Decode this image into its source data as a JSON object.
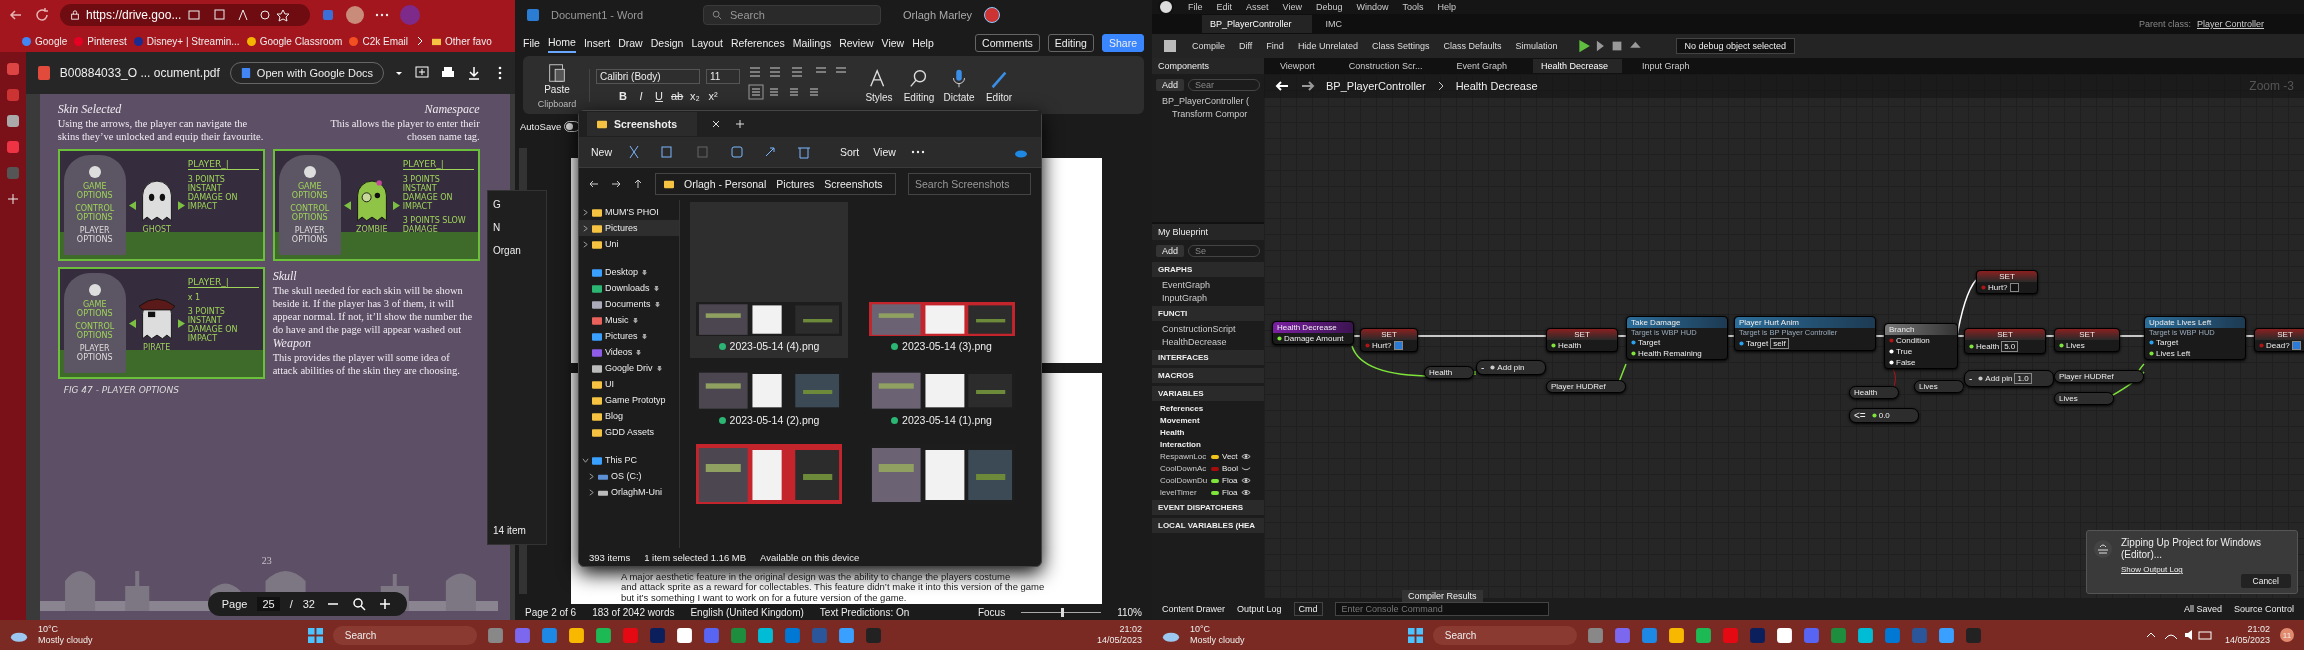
{
  "browser": {
    "url": "https://drive.goo...",
    "bookmarks": [
      {
        "label": "Google",
        "color": "#4285f4"
      },
      {
        "label": "Pinterest",
        "color": "#e60023"
      },
      {
        "label": "Disney+ | Streamin...",
        "color": "#1a2c8f"
      },
      {
        "label": "Google Classroom",
        "color": "#f4b400"
      },
      {
        "label": "C2k Email",
        "color": "#f25022"
      }
    ],
    "other_bookmarks": "Other favo"
  },
  "pdf_viewer": {
    "file_name": "B00884033_O ... ocument.pdf",
    "open_with_button": "Open with Google Docs",
    "page_label": "Page",
    "page": "25",
    "page_separator": "/",
    "page_total": "32"
  },
  "document_page": {
    "skin_selected": {
      "heading": "Skin Selected",
      "lines": [
        "Using the arrows, the player can navigate the",
        "skins they’ve unlocked and equip their favourite."
      ]
    },
    "namespace": {
      "heading": "Namespace",
      "lines": [
        "This allows the player to enter their",
        "chosen name tag."
      ]
    },
    "skull": {
      "heading": "Skull",
      "lines": [
        "The skull needed for each skin will be shown",
        "beside it. If the player has 3 of them, it will",
        "appear normal. If not, it’ll show the number the",
        "do have and the page will appear washed out"
      ]
    },
    "weapon": {
      "heading": "Weapon",
      "lines": [
        "This provides the player will some idea of",
        "attack abilities of the skin they are choosing."
      ]
    },
    "cards": [
      {
        "kind": "ghost",
        "menu": [
          "GAME OPTIONS",
          "CONTROL OPTIONS",
          "PLAYER OPTIONS"
        ],
        "name_tag": "PLAYER_|",
        "skin_name": "GHOST",
        "abilities": [
          "3 POINTS INSTANT DAMAGE ON IMPACT"
        ]
      },
      {
        "kind": "zombie",
        "menu": [
          "GAME OPTIONS",
          "CONTROL OPTIONS",
          "PLAYER OPTIONS"
        ],
        "name_tag": "PLAYER_|",
        "skin_name": "ZOMBIE",
        "abilities": [
          "3 POINTS INSTANT DAMAGE ON IMPACT",
          "3 POINTS SLOW DAMAGE"
        ]
      },
      {
        "kind": "pirate",
        "menu": [
          "GAME OPTIONS",
          "CONTROL OPTIONS",
          "PLAYER OPTIONS"
        ],
        "name_tag": "PLAYER_|",
        "skin_name": "PIRATE",
        "skull_count": "x 1",
        "abilities": [
          "3 POINTS INSTANT DAMAGE ON IMPACT"
        ]
      }
    ],
    "caption": "FIG 47 - PLAYER OPTIONS",
    "page_number": "23"
  },
  "word": {
    "title": "Document1 - Word",
    "search": "Search",
    "user": "Orlagh Marley",
    "tabs": [
      {
        "label": "File",
        "selected": false
      },
      {
        "label": "Home",
        "selected": true
      },
      {
        "label": "Insert",
        "selected": false
      },
      {
        "label": "Draw",
        "selected": false
      },
      {
        "label": "Design",
        "selected": false
      },
      {
        "label": "Layout",
        "selected": false
      },
      {
        "label": "References",
        "selected": false
      },
      {
        "label": "Mailings",
        "selected": false
      },
      {
        "label": "Review",
        "selected": false
      },
      {
        "label": "View",
        "selected": false
      },
      {
        "label": "Help",
        "selected": false
      }
    ],
    "comments_button": "Comments",
    "editing_button": "Editing",
    "share_button": "Share",
    "paste": "Paste",
    "clipboard_group": "Clipboard",
    "font": "Calibri (Body)",
    "font_size": "11",
    "format_buttons": [
      "B",
      "I",
      "U",
      "ab",
      "x₂",
      "x²"
    ],
    "big_buttons": [
      {
        "label": "Styles",
        "kind": "styles"
      },
      {
        "label": "Editing",
        "kind": "editing"
      },
      {
        "label": "Dictate",
        "kind": "dictate"
      },
      {
        "label": "Editor",
        "kind": "editor"
      }
    ],
    "autosave": {
      "label": "AutoSave",
      "on": false
    },
    "body_lines": [
      "A major aesthetic feature in the original design was the ability to change the players costume",
      "and attack sprite as a reward for collectables. This feature didn’t make it into this version of the game",
      "but it’s something I want to work on for a future version of the game."
    ],
    "status": {
      "page": "Page 2 of 6",
      "words": "183 of 2042 words",
      "language": "English (United Kingdom)",
      "predictions": "Text Predictions: On",
      "focus": "Focus",
      "zoom": "110%",
      "zoom_level": {
        "level": 0.5
      }
    }
  },
  "explorer_behind": {
    "tab": "G",
    "new": "N",
    "organise": "Organ",
    "items": "14 item"
  },
  "explorer": {
    "tab": "Screenshots",
    "new": "New",
    "sort": "Sort",
    "view": "View",
    "path": [
      "Orlagh - Personal",
      "Pictures",
      "Screenshots"
    ],
    "search_placeholder": "Search Screenshots",
    "nav_groups": [
      [
        {
          "label": "MUM'S PHOI",
          "kind": "folder",
          "expanded": false,
          "selected": false
        },
        {
          "label": "Pictures",
          "kind": "folder",
          "expanded": false,
          "selected": true
        },
        {
          "label": "Uni",
          "kind": "folder",
          "expanded": false,
          "selected": false
        }
      ],
      [
        {
          "label": "Desktop",
          "kind": "desktop",
          "pinned": true,
          "selected": false
        },
        {
          "label": "Downloads",
          "kind": "downloads",
          "pinned": true,
          "selected": false
        },
        {
          "label": "Documents",
          "kind": "documents",
          "pinned": true,
          "selected": false
        },
        {
          "label": "Music",
          "kind": "music",
          "pinned": true,
          "selected": false
        },
        {
          "label": "Pictures",
          "kind": "pictures",
          "pinned": true,
          "selected": false
        },
        {
          "label": "Videos",
          "kind": "videos",
          "pinned": true,
          "selected": false
        },
        {
          "label": "Google Driv",
          "kind": "drive",
          "pinned": true,
          "selected": false
        },
        {
          "label": "UI",
          "kind": "cloud-folder",
          "selected": false
        },
        {
          "label": "Game Prototyp",
          "kind": "cloud-folder",
          "selected": false
        },
        {
          "label": "Blog",
          "kind": "cloud-folder",
          "selected": false
        },
        {
          "label": "GDD Assets",
          "kind": "cloud-folder",
          "selected": false
        }
      ],
      [
        {
          "label": "This PC",
          "kind": "pc",
          "expanded": true,
          "selected": false,
          "children": [
            {
              "label": "OS (C:)",
              "kind": "disk",
              "expanded": false,
              "selected": false
            },
            {
              "label": "OrlaghM-Uni",
              "kind": "drive",
              "expanded": false,
              "selected": false
            }
          ]
        }
      ]
    ],
    "files": [
      {
        "name": "2023-05-14 (4).png",
        "selected": true
      },
      {
        "name": "2023-05-14 (3).png",
        "selected": false
      },
      {
        "name": "2023-05-14 (2).png",
        "selected": false
      },
      {
        "name": "2023-05-14 (1).png",
        "selected": false
      },
      {
        "selected": false
      },
      {
        "selected": false
      }
    ],
    "status": [
      "393 items",
      "1 item selected  1.16 MB",
      "Available on this device"
    ]
  },
  "taskbar_left": {
    "temperature": "10°C",
    "weather": "Mostly cloudy",
    "search": "Search",
    "time": "21:02",
    "date": "14/05/2023"
  },
  "unreal": {
    "menu": [
      "File",
      "Edit",
      "Asset",
      "View",
      "Debug",
      "Window",
      "Tools",
      "Help"
    ],
    "tabs": [
      {
        "label": "BP_PlayerController",
        "selected": true
      },
      {
        "label": "IMC",
        "selected": false
      }
    ],
    "parent_class_label": "Parent class:",
    "parent_class": "Player Controller",
    "toolbar": [
      "Compile",
      "Diff",
      "Find",
      "Hide Unrelated",
      "Class Settings",
      "Class Defaults",
      "Simulation"
    ],
    "debug_select": "No debug object selected",
    "components": {
      "title": "Components",
      "add": "Add",
      "search": "Sear",
      "tree": [
        "BP_PlayerController (",
        "Transform Compor"
      ]
    },
    "graph_tabs": [
      {
        "label": "Viewport",
        "selected": false
      },
      {
        "label": "Construction Scr...",
        "selected": false
      },
      {
        "label": "Event Graph",
        "selected": false
      },
      {
        "label": "Health Decrease",
        "selected": true
      },
      {
        "label": "Input Graph",
        "selected": false
      }
    ],
    "breadcrumb": [
      "BP_PlayerController",
      "Health Decrease"
    ],
    "zoom": "Zoom -3",
    "my_blueprint": {
      "title": "My Blueprint",
      "add": "Add",
      "search": "Se",
      "sections": [
        {
          "title": "GRAPHS",
          "items": [
            "EventGraph",
            "InputGraph"
          ]
        },
        {
          "title": "FUNCTI",
          "items": [
            "ConstructionScript",
            "HealthDecrease"
          ]
        },
        {
          "title": "INTERFACES"
        },
        {
          "title": "MACROS"
        },
        {
          "title": "VARIABLES",
          "categories": [
            "References",
            "Movement",
            "Health",
            "Interaction"
          ],
          "variables": [
            {
              "name": "RespawnLoc",
              "type": "Vect",
              "color": "#f2c319",
              "visible": true
            },
            {
              "name": "CoolDownAc",
              "type": "Bool",
              "color": "#a50d0d",
              "visible": false
            },
            {
              "name": "CoolDownDu",
              "type": "Floa",
              "color": "#7ee33b",
              "visible": true
            },
            {
              "name": "levelTimer",
              "type": "Floa",
              "color": "#7ee33b",
              "visible": true
            }
          ]
        },
        {
          "title": "EVENT DISPATCHERS"
        },
        {
          "title": "LOCAL VARIABLES (HEA"
        }
      ]
    },
    "nodes": [
      {
        "kind": "event",
        "title": "Health Decrease",
        "pins": [
          {
            "label": "Damage Amount",
            "kind": "float"
          }
        ]
      },
      {
        "kind": "set",
        "title": "SET",
        "pins": [
          {
            "label": "Hurt?",
            "kind": "bool",
            "checked": true
          }
        ]
      },
      {
        "kind": "get",
        "title": "Health"
      },
      {
        "kind": "op",
        "title": "-",
        "pins": [
          {
            "label": "Add pin",
            "kind": "add"
          }
        ]
      },
      {
        "kind": "set",
        "title": "SET",
        "pins": [
          {
            "label": "Health",
            "kind": "float"
          }
        ]
      },
      {
        "kind": "get",
        "title": "Player HUDRef"
      },
      {
        "kind": "call",
        "title": "Take Damage",
        "subtitle": "Target is WBP HUD",
        "pins": [
          {
            "label": "Target",
            "kind": "object"
          },
          {
            "label": "Health Remaining",
            "kind": "float"
          }
        ]
      },
      {
        "kind": "call",
        "title": "Player Hurt Anim",
        "subtitle": "Target is BP Player Controller",
        "pins": [
          {
            "label": "Target",
            "kind": "object",
            "value": "self"
          }
        ]
      },
      {
        "kind": "branch",
        "title": "Branch",
        "pins": [
          {
            "label": "Condition",
            "kind": "bool"
          },
          {
            "label": "True",
            "kind": "exec"
          },
          {
            "label": "False",
            "kind": "exec"
          }
        ]
      },
      {
        "kind": "set",
        "title": "SET",
        "pins": [
          {
            "label": "Hurt?",
            "kind": "bool",
            "checked": false
          }
        ]
      },
      {
        "kind": "get",
        "title": "Health"
      },
      {
        "kind": "op",
        "title": "<=",
        "pins": [
          {
            "label": "0.0",
            "kind": "value"
          }
        ]
      },
      {
        "kind": "set",
        "title": "SET",
        "pins": [
          {
            "label": "Health",
            "kind": "float",
            "value": "5.0"
          }
        ]
      },
      {
        "kind": "get",
        "title": "Lives"
      },
      {
        "kind": "op",
        "title": "-",
        "pins": [
          {
            "label": "Add pin",
            "kind": "add",
            "value": "1.0"
          }
        ]
      },
      {
        "kind": "set",
        "title": "SET",
        "pins": [
          {
            "label": "Lives",
            "kind": "float"
          }
        ]
      },
      {
        "kind": "get",
        "title": "Player HUDRef"
      },
      {
        "kind": "get",
        "title": "Lives"
      },
      {
        "kind": "call",
        "title": "Update Lives Left",
        "subtitle": "Target is WBP HUD",
        "pins": [
          {
            "label": "Target",
            "kind": "object"
          },
          {
            "label": "Lives Left",
            "kind": "float"
          }
        ]
      },
      {
        "kind": "set",
        "title": "SET",
        "pins": [
          {
            "label": "Dead?",
            "kind": "bool",
            "checked": true
          }
        ]
      }
    ],
    "toast": {
      "title": "Zipping Up Project for Windows (Editor)...",
      "link": "Show Output Log",
      "button": "Cancel"
    },
    "bottom_bar": {
      "content_drawer": "Content Drawer",
      "output_log": "Output Log",
      "cmd": "Cmd",
      "console_placeholder": "Enter Console Command",
      "compiler_results": "Compiler Results",
      "saved": "All Saved",
      "source_control": "Source Control"
    }
  },
  "taskbar_right": {
    "temperature": "10°C",
    "weather": "Mostly cloudy",
    "search": "Search",
    "time": "21:02",
    "date": "14/05/2023",
    "notification_count": "11"
  }
}
